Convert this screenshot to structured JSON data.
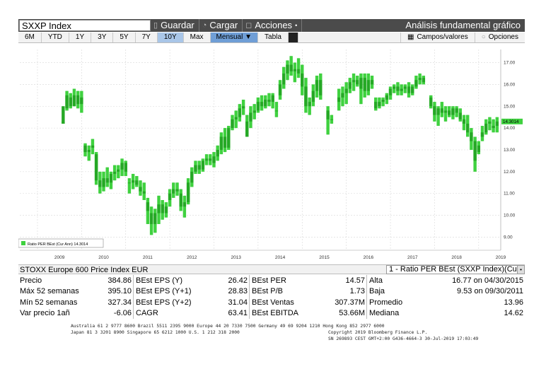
{
  "toolbar": {
    "ticker": "SXXP Index",
    "save_label": "Guardar",
    "load_label": "Cargar",
    "actions_label": "Acciones",
    "actions_arrow": "•",
    "title": "Análisis fundamental gráfico"
  },
  "range_bar": {
    "ranges": [
      "6M",
      "YTD",
      "1Y",
      "3Y",
      "5Y",
      "7Y",
      "10Y",
      "Max"
    ],
    "active_range": "10Y",
    "frequency": "Mensual ▼",
    "table_label": "Tabla",
    "fields_label": "Campos/valores",
    "options_label": "Opciones"
  },
  "chart_data": {
    "type": "bar",
    "subtype": "ohlc-range-bars",
    "x_tick_labels": [
      "2009",
      "2010",
      "2011",
      "2012",
      "2013",
      "2014",
      "2015",
      "2016",
      "2017",
      "2018",
      "2019"
    ],
    "y_ticks": [
      9.0,
      10.0,
      11.0,
      12.0,
      13.0,
      14.0,
      15.0,
      16.0,
      17.0
    ],
    "y_tick_labels": [
      "9.00",
      "10.00",
      "11.00",
      "12.00",
      "13.00",
      "14.00",
      "15.00",
      "16.00",
      "17.00"
    ],
    "ylim": [
      8.4,
      17.6
    ],
    "xlim": [
      2008.6,
      2019.5
    ],
    "last_value_label": "14.3014",
    "last_value": 14.3,
    "legend": "Ratio PER BEst (Cur Ann) 14.3014",
    "bar_color": "#3fd13f",
    "grid": true,
    "series": [
      {
        "name": "Ratio PER BEst (Cur Ann)",
        "points": [
          [
            2009.583,
            14.2,
            14.3,
            14.2,
            15.0
          ],
          [
            2009.667,
            14.9,
            15.7,
            14.8,
            15.5
          ],
          [
            2009.75,
            15.4,
            15.6,
            14.9,
            15.0
          ],
          [
            2009.833,
            15.0,
            15.8,
            15.0,
            15.5
          ],
          [
            2009.917,
            15.5,
            15.7,
            14.9,
            15.1
          ],
          [
            2010.0,
            15.1,
            15.7,
            14.7,
            15.4
          ],
          [
            2010.083,
            13.2,
            13.3,
            12.7,
            12.9
          ],
          [
            2010.167,
            12.9,
            13.2,
            12.5,
            13.0
          ],
          [
            2010.25,
            13.1,
            13.5,
            12.8,
            13.2
          ],
          [
            2010.333,
            12.8,
            12.9,
            11.4,
            11.6
          ],
          [
            2010.417,
            11.6,
            12.0,
            11.0,
            11.3
          ],
          [
            2010.5,
            11.3,
            12.0,
            11.1,
            11.7
          ],
          [
            2010.583,
            11.7,
            12.2,
            11.3,
            11.5
          ],
          [
            2010.667,
            11.5,
            12.0,
            11.2,
            11.9
          ],
          [
            2010.75,
            11.9,
            12.3,
            11.6,
            12.0
          ],
          [
            2010.833,
            12.0,
            12.3,
            11.7,
            12.1
          ],
          [
            2010.917,
            12.1,
            12.6,
            11.8,
            12.4
          ],
          [
            2011.0,
            12.4,
            12.5,
            11.8,
            12.0
          ],
          [
            2011.083,
            11.5,
            11.7,
            11.0,
            11.5
          ],
          [
            2011.167,
            11.5,
            11.9,
            11.2,
            11.6
          ],
          [
            2011.25,
            11.6,
            11.8,
            11.3,
            11.4
          ],
          [
            2011.333,
            11.3,
            11.6,
            10.9,
            11.1
          ],
          [
            2011.417,
            11.1,
            11.5,
            10.7,
            11.0
          ],
          [
            2011.5,
            10.6,
            10.8,
            9.6,
            10.2
          ],
          [
            2011.583,
            10.1,
            10.4,
            9.1,
            9.6
          ],
          [
            2011.667,
            9.6,
            10.3,
            9.2,
            10.1
          ],
          [
            2011.75,
            10.1,
            10.9,
            9.6,
            10.5
          ],
          [
            2011.833,
            10.5,
            10.7,
            9.8,
            10.1
          ],
          [
            2011.917,
            10.1,
            10.6,
            9.9,
            10.4
          ],
          [
            2012.0,
            10.7,
            11.2,
            10.4,
            11.0
          ],
          [
            2012.083,
            11.0,
            11.5,
            10.8,
            11.2
          ],
          [
            2012.167,
            11.2,
            11.5,
            10.9,
            11.1
          ],
          [
            2012.25,
            11.0,
            11.2,
            10.2,
            10.4
          ],
          [
            2012.333,
            10.4,
            10.9,
            9.9,
            10.6
          ],
          [
            2012.417,
            10.6,
            11.7,
            10.5,
            11.5
          ],
          [
            2012.5,
            11.5,
            12.2,
            11.3,
            12.0
          ],
          [
            2012.583,
            12.0,
            12.5,
            11.9,
            12.3
          ],
          [
            2012.667,
            12.3,
            12.5,
            11.9,
            12.1
          ],
          [
            2012.75,
            12.1,
            12.6,
            12.0,
            12.5
          ],
          [
            2012.833,
            12.5,
            12.8,
            12.3,
            12.6
          ],
          [
            2012.917,
            12.6,
            12.8,
            12.3,
            12.5
          ],
          [
            2013.0,
            12.4,
            12.9,
            12.2,
            12.7
          ],
          [
            2013.083,
            12.7,
            13.2,
            12.5,
            13.0
          ],
          [
            2013.167,
            13.0,
            13.8,
            12.8,
            13.6
          ],
          [
            2013.25,
            13.6,
            14.0,
            12.9,
            13.1
          ],
          [
            2013.333,
            13.1,
            14.1,
            13.0,
            14.0
          ],
          [
            2013.417,
            14.0,
            14.6,
            13.9,
            14.4
          ],
          [
            2013.5,
            14.4,
            14.8,
            14.0,
            14.5
          ],
          [
            2013.583,
            14.5,
            15.1,
            14.3,
            14.9
          ],
          [
            2013.667,
            14.9,
            15.3,
            14.6,
            15.0
          ],
          [
            2013.75,
            13.6,
            14.6,
            13.6,
            14.3
          ],
          [
            2013.833,
            14.3,
            15.0,
            14.0,
            14.7
          ],
          [
            2013.917,
            14.7,
            15.1,
            14.4,
            14.8
          ],
          [
            2014.0,
            14.8,
            15.4,
            14.7,
            15.2
          ],
          [
            2014.083,
            15.2,
            15.5,
            14.8,
            15.0
          ],
          [
            2014.167,
            15.0,
            15.5,
            14.9,
            15.3
          ],
          [
            2014.25,
            15.3,
            15.6,
            15.0,
            15.2
          ],
          [
            2014.333,
            15.2,
            15.6,
            14.9,
            15.5
          ],
          [
            2014.417,
            14.8,
            15.2,
            14.5,
            14.8
          ],
          [
            2014.5,
            15.5,
            16.2,
            15.3,
            16.0
          ],
          [
            2014.583,
            16.0,
            16.8,
            15.8,
            16.5
          ],
          [
            2014.667,
            16.5,
            17.1,
            16.2,
            16.9
          ],
          [
            2014.75,
            16.9,
            17.3,
            16.4,
            16.6
          ],
          [
            2014.833,
            16.6,
            17.0,
            16.1,
            16.7
          ],
          [
            2014.917,
            16.7,
            17.2,
            16.3,
            16.5
          ],
          [
            2015.0,
            16.5,
            16.9,
            15.5,
            15.9
          ],
          [
            2015.083,
            15.9,
            16.3,
            14.7,
            15.0
          ],
          [
            2015.167,
            15.0,
            15.4,
            14.6,
            15.2
          ],
          [
            2015.25,
            15.2,
            16.0,
            15.0,
            15.7
          ],
          [
            2015.333,
            15.7,
            16.4,
            15.4,
            16.2
          ],
          [
            2015.417,
            16.2,
            16.5,
            15.3,
            15.5
          ],
          [
            2015.583,
            14.8,
            15.0,
            13.7,
            14.4
          ],
          [
            2015.667,
            14.4,
            14.6,
            14.2,
            14.4
          ],
          [
            2015.833,
            15.2,
            15.8,
            14.8,
            15.4
          ],
          [
            2015.917,
            15.4,
            15.9,
            15.0,
            15.6
          ],
          [
            2016.0,
            15.6,
            16.1,
            15.1,
            15.8
          ],
          [
            2016.083,
            15.8,
            16.3,
            15.6,
            16.1
          ],
          [
            2016.167,
            16.1,
            16.5,
            15.7,
            16.2
          ],
          [
            2016.25,
            16.2,
            16.4,
            15.9,
            16.0
          ],
          [
            2016.333,
            15.8,
            16.5,
            15.1,
            16.3
          ],
          [
            2016.417,
            16.3,
            16.5,
            15.4,
            15.7
          ],
          [
            2016.5,
            15.7,
            16.5,
            15.5,
            16.2
          ],
          [
            2016.583,
            16.2,
            16.4,
            15.8,
            16.0
          ],
          [
            2016.667,
            14.9,
            15.4,
            14.8,
            15.2
          ],
          [
            2016.75,
            15.2,
            15.4,
            14.9,
            15.0
          ],
          [
            2016.833,
            15.2,
            15.4,
            15.0,
            15.3
          ],
          [
            2016.917,
            15.3,
            15.6,
            15.1,
            15.5
          ],
          [
            2017.0,
            15.5,
            15.9,
            15.3,
            15.8
          ],
          [
            2017.083,
            15.8,
            16.0,
            15.6,
            15.9
          ],
          [
            2017.167,
            15.9,
            16.1,
            15.5,
            15.7
          ],
          [
            2017.25,
            15.7,
            16.0,
            15.5,
            15.8
          ],
          [
            2017.333,
            15.8,
            16.0,
            15.6,
            15.9
          ],
          [
            2017.417,
            15.9,
            16.1,
            15.4,
            15.6
          ],
          [
            2017.5,
            15.6,
            16.0,
            15.5,
            15.9
          ],
          [
            2017.583,
            15.9,
            16.4,
            15.8,
            16.2
          ],
          [
            2017.667,
            16.2,
            16.5,
            16.0,
            16.3
          ],
          [
            2017.75,
            16.3,
            16.4,
            16.0,
            16.1
          ],
          [
            2017.917,
            15.4,
            15.5,
            14.9,
            15.0
          ],
          [
            2018.0,
            15.0,
            15.2,
            14.3,
            14.6
          ],
          [
            2018.083,
            14.6,
            15.0,
            14.1,
            14.9
          ],
          [
            2018.167,
            14.9,
            15.2,
            14.5,
            14.7
          ],
          [
            2018.25,
            14.7,
            15.0,
            14.3,
            14.8
          ],
          [
            2018.333,
            14.8,
            15.0,
            14.5,
            14.6
          ],
          [
            2018.417,
            14.6,
            15.0,
            14.4,
            14.9
          ],
          [
            2018.5,
            14.9,
            15.0,
            14.5,
            14.7
          ],
          [
            2018.583,
            14.7,
            14.9,
            14.3,
            14.4
          ],
          [
            2018.667,
            14.4,
            14.6,
            13.9,
            14.2
          ],
          [
            2018.75,
            14.2,
            14.6,
            13.6,
            13.8
          ],
          [
            2018.833,
            13.8,
            14.0,
            13.0,
            13.4
          ],
          [
            2018.917,
            13.4,
            13.6,
            12.0,
            12.5
          ],
          [
            2019.0,
            12.9,
            13.4,
            12.8,
            13.2
          ],
          [
            2019.083,
            13.6,
            14.1,
            13.4,
            13.8
          ],
          [
            2019.167,
            13.8,
            14.4,
            13.7,
            14.2
          ],
          [
            2019.25,
            14.2,
            14.5,
            13.9,
            14.3
          ],
          [
            2019.333,
            14.0,
            14.4,
            13.8,
            14.1
          ],
          [
            2019.417,
            14.1,
            14.5,
            13.8,
            14.3
          ]
        ]
      }
    ]
  },
  "stats": {
    "security": "STOXX Europe 600 Price Index EUR",
    "selector": "1 - Ratio PER BEst (SXXP Index)(Cu",
    "selector_arrow": "•",
    "col1": [
      {
        "label": "Precio",
        "value": "384.86"
      },
      {
        "label": "Máx 52 semanas",
        "value": "395.10"
      },
      {
        "label": "Mín 52 semanas",
        "value": "327.34"
      },
      {
        "label": "Var precio 1añ",
        "value": "-6.06"
      }
    ],
    "col2": [
      {
        "label": "BEst EPS (Y)",
        "value": "26.42"
      },
      {
        "label": "BEst EPS (Y+1)",
        "value": "28.83"
      },
      {
        "label": "BEst EPS (Y+2)",
        "value": "31.04"
      },
      {
        "label": "CAGR",
        "value": "63.41"
      }
    ],
    "col3": [
      {
        "label": "BEst PER",
        "value": "14.57"
      },
      {
        "label": "BEst P/B",
        "value": "1.73"
      },
      {
        "label": "BEst Ventas",
        "value": "307.37M"
      },
      {
        "label": "BEst EBITDA",
        "value": "53.66M"
      }
    ],
    "col4": [
      {
        "label": "Alta",
        "value": "16.77 on 04/30/2015"
      },
      {
        "label": "Baja",
        "value": "9.53 on 09/30/2011"
      },
      {
        "label": "Promedio",
        "value": "13.96"
      },
      {
        "label": "Mediana",
        "value": "14.62"
      }
    ]
  },
  "footer": {
    "line1": "Australia 61 2 9777 8600 Brazil 5511 2395 9000 Europe 44 20 7330 7500 Germany 49 69 9204 1210 Hong Kong 852 2977 6000",
    "line2": "Japan 81 3 3201 8900       Singapore 65 6212 1000      U.S. 1 212 318 2000",
    "line3": "Copyright 2019 Bloomberg Finance L.P.",
    "line4": "SN 269893 CEST GMT+2:00 G436-4664-3 30-Jul-2019 17:03:49"
  }
}
